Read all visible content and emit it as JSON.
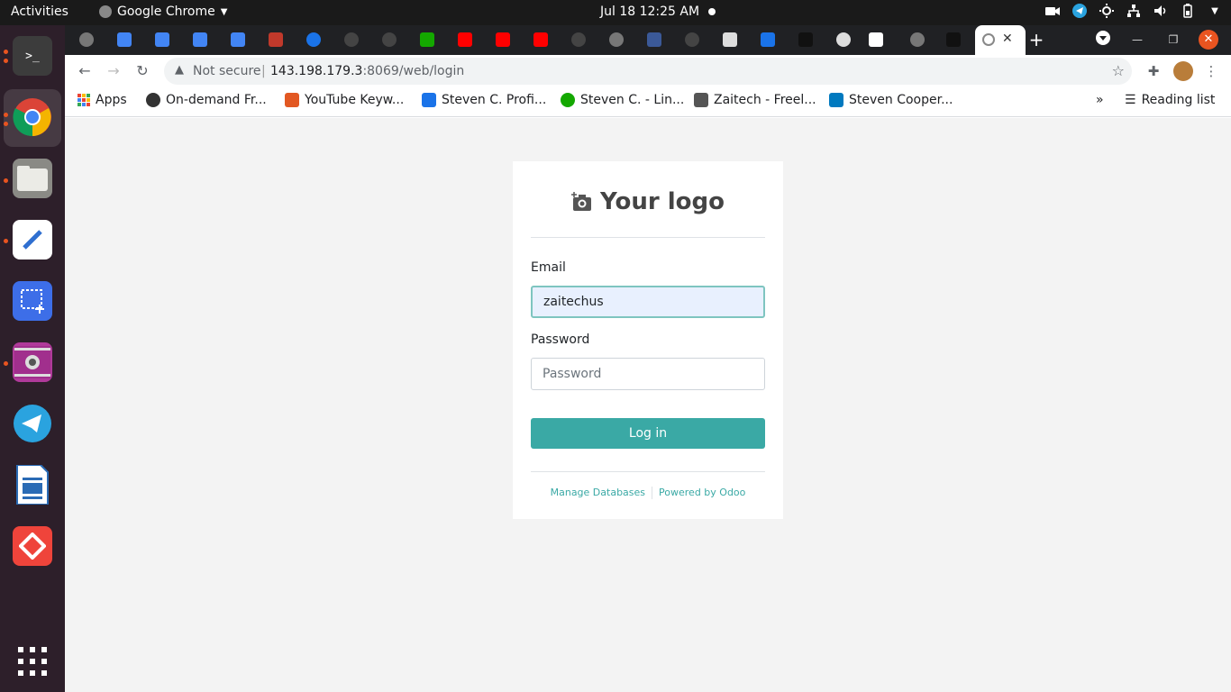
{
  "topbar": {
    "activities": "Activities",
    "app_name": "Google Chrome",
    "datetime": "Jul 18  12:25 AM"
  },
  "browser": {
    "url_security": "Not secure",
    "url_host": "143.198.179.3",
    "url_path": ":8069/web/login",
    "active_tab_close": "✕"
  },
  "bookmarks": [
    {
      "label": "Apps",
      "color": "#ea4335"
    },
    {
      "label": "On-demand Fr...",
      "color": "#333333"
    },
    {
      "label": "YouTube Keyw...",
      "color": "#e25822"
    },
    {
      "label": "Steven C. Profi...",
      "color": "#1a73e8"
    },
    {
      "label": "Steven C. - Lin...",
      "color": "#14a800"
    },
    {
      "label": "Zaitech - Freel...",
      "color": "#555555"
    },
    {
      "label": "Steven Cooper...",
      "color": "#0079bf"
    }
  ],
  "bookmarks_more": "»",
  "reading_list": "Reading list",
  "login": {
    "logo_text": "Your logo",
    "email_label": "Email",
    "email_value": "zaitechus",
    "password_label": "Password",
    "password_placeholder": "Password",
    "login_button": "Log in",
    "manage_databases": "Manage Databases",
    "powered_by": "Powered by Odoo"
  },
  "colors": {
    "accent": "#3aa9a5",
    "topbar": "#1a1a1a",
    "dock": "#2d1f2a",
    "tabstrip": "#202124",
    "close": "#e95420"
  }
}
